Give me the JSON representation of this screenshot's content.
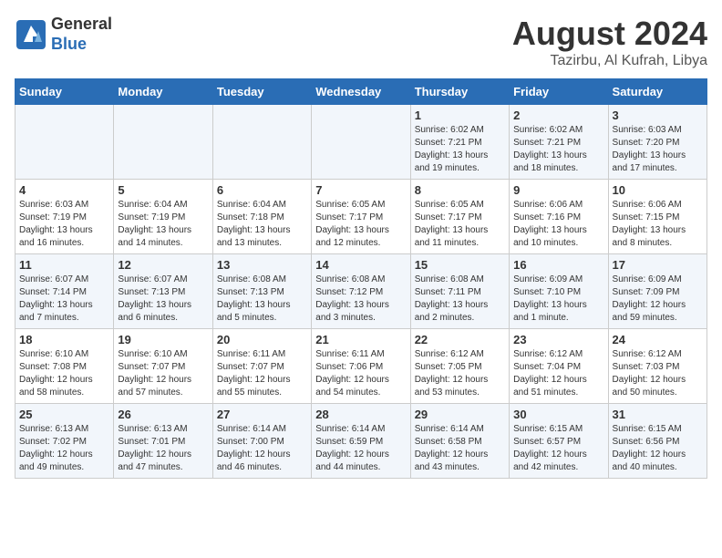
{
  "header": {
    "logo_line1": "General",
    "logo_line2": "Blue",
    "month_year": "August 2024",
    "location": "Tazirbu, Al Kufrah, Libya"
  },
  "weekdays": [
    "Sunday",
    "Monday",
    "Tuesday",
    "Wednesday",
    "Thursday",
    "Friday",
    "Saturday"
  ],
  "weeks": [
    [
      {
        "day": "",
        "info": ""
      },
      {
        "day": "",
        "info": ""
      },
      {
        "day": "",
        "info": ""
      },
      {
        "day": "",
        "info": ""
      },
      {
        "day": "1",
        "info": "Sunrise: 6:02 AM\nSunset: 7:21 PM\nDaylight: 13 hours\nand 19 minutes."
      },
      {
        "day": "2",
        "info": "Sunrise: 6:02 AM\nSunset: 7:21 PM\nDaylight: 13 hours\nand 18 minutes."
      },
      {
        "day": "3",
        "info": "Sunrise: 6:03 AM\nSunset: 7:20 PM\nDaylight: 13 hours\nand 17 minutes."
      }
    ],
    [
      {
        "day": "4",
        "info": "Sunrise: 6:03 AM\nSunset: 7:19 PM\nDaylight: 13 hours\nand 16 minutes."
      },
      {
        "day": "5",
        "info": "Sunrise: 6:04 AM\nSunset: 7:19 PM\nDaylight: 13 hours\nand 14 minutes."
      },
      {
        "day": "6",
        "info": "Sunrise: 6:04 AM\nSunset: 7:18 PM\nDaylight: 13 hours\nand 13 minutes."
      },
      {
        "day": "7",
        "info": "Sunrise: 6:05 AM\nSunset: 7:17 PM\nDaylight: 13 hours\nand 12 minutes."
      },
      {
        "day": "8",
        "info": "Sunrise: 6:05 AM\nSunset: 7:17 PM\nDaylight: 13 hours\nand 11 minutes."
      },
      {
        "day": "9",
        "info": "Sunrise: 6:06 AM\nSunset: 7:16 PM\nDaylight: 13 hours\nand 10 minutes."
      },
      {
        "day": "10",
        "info": "Sunrise: 6:06 AM\nSunset: 7:15 PM\nDaylight: 13 hours\nand 8 minutes."
      }
    ],
    [
      {
        "day": "11",
        "info": "Sunrise: 6:07 AM\nSunset: 7:14 PM\nDaylight: 13 hours\nand 7 minutes."
      },
      {
        "day": "12",
        "info": "Sunrise: 6:07 AM\nSunset: 7:13 PM\nDaylight: 13 hours\nand 6 minutes."
      },
      {
        "day": "13",
        "info": "Sunrise: 6:08 AM\nSunset: 7:13 PM\nDaylight: 13 hours\nand 5 minutes."
      },
      {
        "day": "14",
        "info": "Sunrise: 6:08 AM\nSunset: 7:12 PM\nDaylight: 13 hours\nand 3 minutes."
      },
      {
        "day": "15",
        "info": "Sunrise: 6:08 AM\nSunset: 7:11 PM\nDaylight: 13 hours\nand 2 minutes."
      },
      {
        "day": "16",
        "info": "Sunrise: 6:09 AM\nSunset: 7:10 PM\nDaylight: 13 hours\nand 1 minute."
      },
      {
        "day": "17",
        "info": "Sunrise: 6:09 AM\nSunset: 7:09 PM\nDaylight: 12 hours\nand 59 minutes."
      }
    ],
    [
      {
        "day": "18",
        "info": "Sunrise: 6:10 AM\nSunset: 7:08 PM\nDaylight: 12 hours\nand 58 minutes."
      },
      {
        "day": "19",
        "info": "Sunrise: 6:10 AM\nSunset: 7:07 PM\nDaylight: 12 hours\nand 57 minutes."
      },
      {
        "day": "20",
        "info": "Sunrise: 6:11 AM\nSunset: 7:07 PM\nDaylight: 12 hours\nand 55 minutes."
      },
      {
        "day": "21",
        "info": "Sunrise: 6:11 AM\nSunset: 7:06 PM\nDaylight: 12 hours\nand 54 minutes."
      },
      {
        "day": "22",
        "info": "Sunrise: 6:12 AM\nSunset: 7:05 PM\nDaylight: 12 hours\nand 53 minutes."
      },
      {
        "day": "23",
        "info": "Sunrise: 6:12 AM\nSunset: 7:04 PM\nDaylight: 12 hours\nand 51 minutes."
      },
      {
        "day": "24",
        "info": "Sunrise: 6:12 AM\nSunset: 7:03 PM\nDaylight: 12 hours\nand 50 minutes."
      }
    ],
    [
      {
        "day": "25",
        "info": "Sunrise: 6:13 AM\nSunset: 7:02 PM\nDaylight: 12 hours\nand 49 minutes."
      },
      {
        "day": "26",
        "info": "Sunrise: 6:13 AM\nSunset: 7:01 PM\nDaylight: 12 hours\nand 47 minutes."
      },
      {
        "day": "27",
        "info": "Sunrise: 6:14 AM\nSunset: 7:00 PM\nDaylight: 12 hours\nand 46 minutes."
      },
      {
        "day": "28",
        "info": "Sunrise: 6:14 AM\nSunset: 6:59 PM\nDaylight: 12 hours\nand 44 minutes."
      },
      {
        "day": "29",
        "info": "Sunrise: 6:14 AM\nSunset: 6:58 PM\nDaylight: 12 hours\nand 43 minutes."
      },
      {
        "day": "30",
        "info": "Sunrise: 6:15 AM\nSunset: 6:57 PM\nDaylight: 12 hours\nand 42 minutes."
      },
      {
        "day": "31",
        "info": "Sunrise: 6:15 AM\nSunset: 6:56 PM\nDaylight: 12 hours\nand 40 minutes."
      }
    ]
  ]
}
